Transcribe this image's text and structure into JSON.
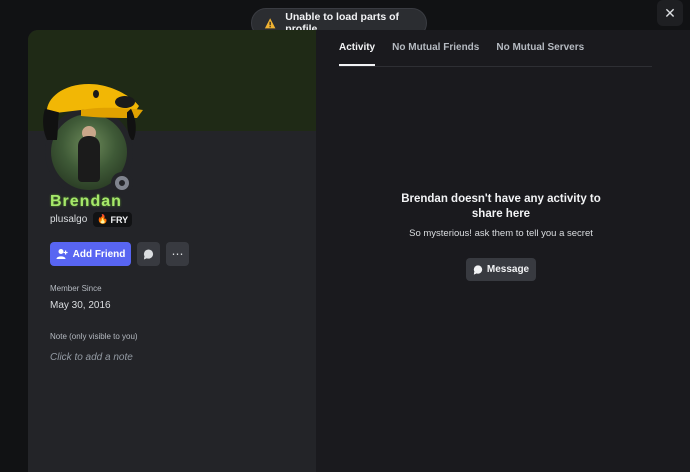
{
  "toast": {
    "message": "Unable to load parts of profile",
    "icon": "warning-icon"
  },
  "close": {
    "glyph": "✕"
  },
  "profile": {
    "display_name": "Brendan",
    "username": "plusalgo",
    "tag": {
      "emoji": "🔥",
      "label": "FRY"
    },
    "add_friend_label": "Add Friend",
    "more_glyph": "⋯",
    "member_since_label": "Member Since",
    "member_since_value": "May 30, 2016",
    "note_label": "Note (only visible to you)",
    "note_placeholder": "Click to add a note",
    "name_color": "#a6e86a"
  },
  "tabs": [
    {
      "label": "Activity",
      "active": true
    },
    {
      "label": "No Mutual Friends",
      "active": false
    },
    {
      "label": "No Mutual Servers",
      "active": false
    }
  ],
  "empty_state": {
    "title": "Brendan doesn't have any activity to share here",
    "subtitle": "So mysterious! ask them to tell you a secret",
    "message_button": "Message"
  },
  "colors": {
    "accent": "#5865f2",
    "background": "#111214",
    "panel": "#232428"
  }
}
